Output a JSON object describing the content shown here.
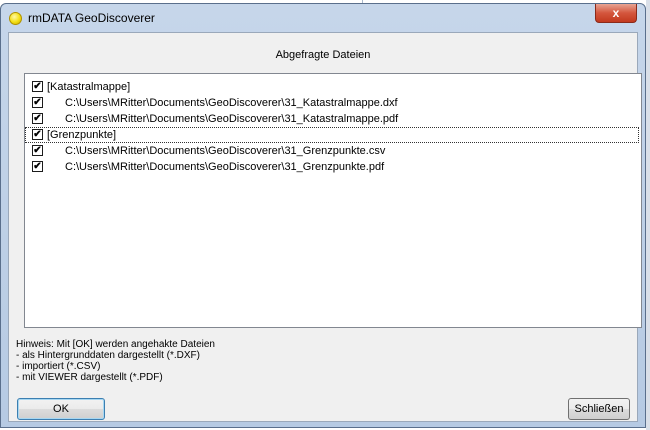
{
  "window": {
    "title": "rmDATA GeoDiscoverer",
    "close_glyph": "x",
    "icon": "yellow-circle-app-icon"
  },
  "group_title": "Abgefragte Dateien",
  "list": {
    "rows": [
      {
        "kind": "group",
        "label": "[Katastralmappe]",
        "checked": true
      },
      {
        "kind": "file",
        "label": "C:\\Users\\MRitter\\Documents\\GeoDiscoverer\\31_Katastralmappe.dxf",
        "checked": true
      },
      {
        "kind": "file",
        "label": "C:\\Users\\MRitter\\Documents\\GeoDiscoverer\\31_Katastralmappe.pdf",
        "checked": true
      },
      {
        "kind": "group",
        "label": "[Grenzpunkte]",
        "checked": true,
        "focused": true
      },
      {
        "kind": "file",
        "label": "C:\\Users\\MRitter\\Documents\\GeoDiscoverer\\31_Grenzpunkte.csv",
        "checked": true
      },
      {
        "kind": "file",
        "label": "C:\\Users\\MRitter\\Documents\\GeoDiscoverer\\31_Grenzpunkte.pdf",
        "checked": true
      }
    ]
  },
  "hint": {
    "lines": [
      "Hinweis: Mit [OK] werden angehakte Dateien",
      "- als Hintergrunddaten dargestellt (*.DXF)",
      "- importiert (*.CSV)",
      "- mit VIEWER dargestellt (*.PDF)"
    ]
  },
  "buttons": {
    "ok": "OK",
    "close": "Schließen"
  },
  "colors": {
    "titlebar": "#b9cce5",
    "close_button": "#c94a31",
    "dialog_bg": "#f0f0f0",
    "list_bg": "#ffffff"
  }
}
